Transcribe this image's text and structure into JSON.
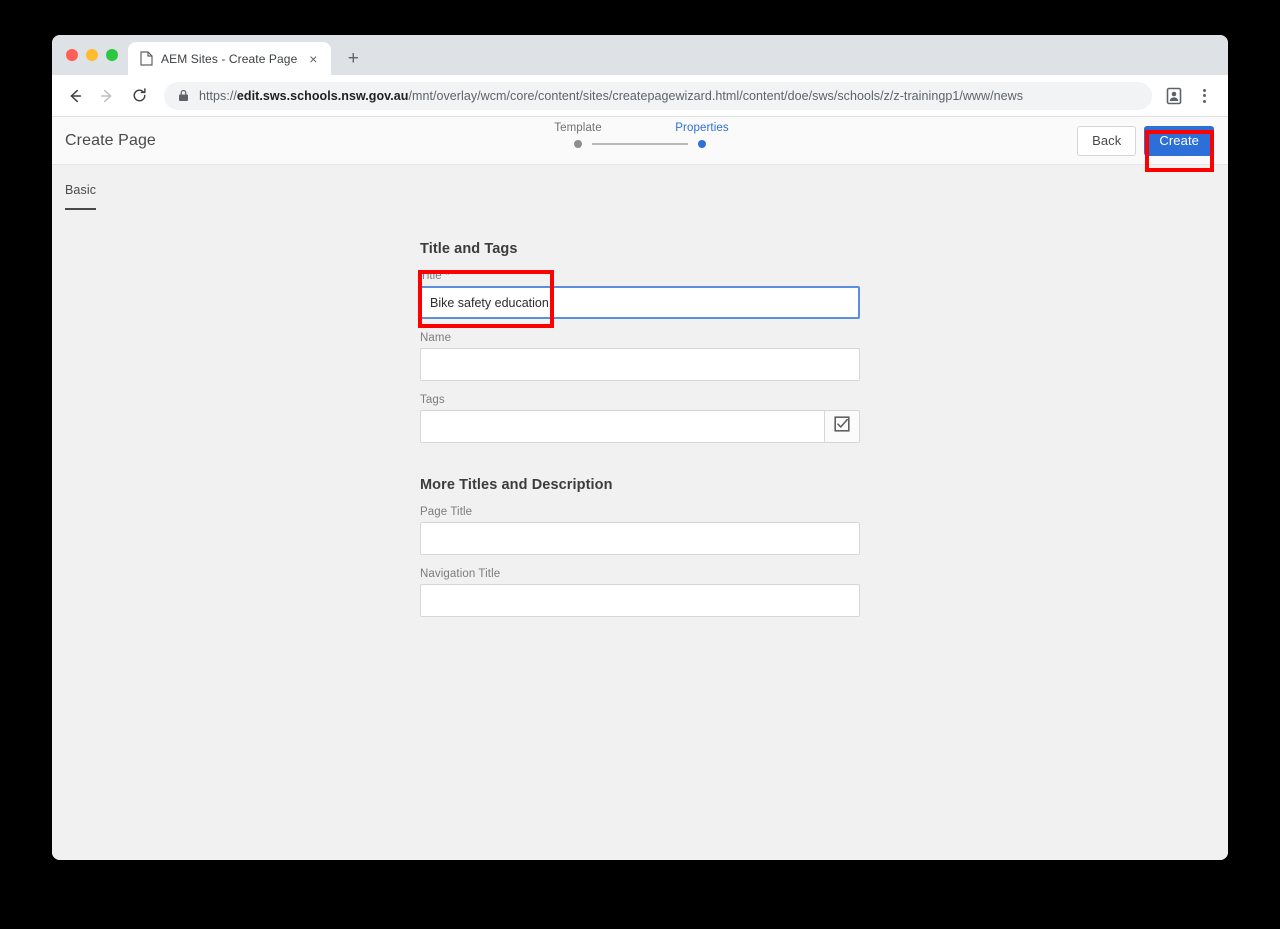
{
  "browser": {
    "tab": {
      "title": "AEM Sites - Create Page",
      "favicon_icon": "document-icon",
      "close_icon": "close-icon",
      "close_label": "×"
    },
    "new_tab_label": "+",
    "new_tab_icon": "plus-icon",
    "nav": {
      "back_icon": "arrow-left-icon",
      "forward_icon": "arrow-right-icon",
      "reload_icon": "reload-icon"
    },
    "omnibox": {
      "lock_icon": "lock-icon",
      "scheme": "https://",
      "host": "edit.sws.schools.nsw.gov.au",
      "path": "/mnt/overlay/wcm/core/content/sites/createpagewizard.html/content/doe/sws/schools/z/z-trainingp1/www/news",
      "full_url": "https://edit.sws.schools.nsw.gov.au/mnt/overlay/wcm/core/content/sites/createpagewizard.html/content/doe/sws/schools/z/z-trainingp1/www/news"
    },
    "profile_icon": "profile-badge-icon",
    "menu_icon": "kebab-menu-icon"
  },
  "header": {
    "title": "Create Page",
    "stepper": [
      {
        "label": "Template",
        "state": "completed"
      },
      {
        "label": "Properties",
        "state": "active"
      }
    ],
    "back_label": "Back",
    "create_label": "Create"
  },
  "tabs": [
    {
      "label": "Basic",
      "active": true
    }
  ],
  "form": {
    "section_one": {
      "heading": "Title and Tags",
      "fields": {
        "title": {
          "label": "Title *",
          "value": "Bike safety education",
          "placeholder": ""
        },
        "name": {
          "label": "Name",
          "value": "",
          "placeholder": ""
        },
        "tags": {
          "label": "Tags",
          "value": "",
          "placeholder": "",
          "browse_icon": "checkbox-checked-icon"
        }
      }
    },
    "section_two": {
      "heading": "More Titles and Description",
      "fields": {
        "page_title": {
          "label": "Page Title",
          "value": "",
          "placeholder": ""
        },
        "navigation_title": {
          "label": "Navigation Title",
          "value": "",
          "placeholder": ""
        }
      }
    }
  },
  "colors": {
    "accent_blue": "#2d6fd8",
    "annotation_red": "#ff0000",
    "page_bg": "#f1f1f1",
    "header_bg": "#fafafa",
    "focus_border": "#5b8fdd"
  }
}
